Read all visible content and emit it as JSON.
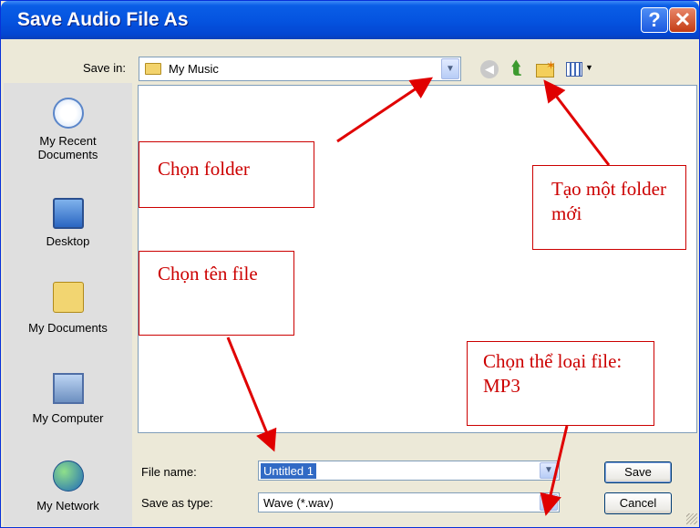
{
  "window": {
    "title": "Save Audio File As",
    "help_glyph": "?",
    "close_glyph": "✕"
  },
  "save_in": {
    "label": "Save in:",
    "value": "My Music"
  },
  "toolbar": {
    "back_glyph": "◀",
    "up_glyph": "⮬"
  },
  "places": [
    {
      "label": "My Recent Documents",
      "icon": "recent-documents-icon"
    },
    {
      "label": "Desktop",
      "icon": "desktop-icon"
    },
    {
      "label": "My Documents",
      "icon": "my-documents-icon"
    },
    {
      "label": "My Computer",
      "icon": "my-computer-icon"
    },
    {
      "label": "My Network",
      "icon": "my-network-icon"
    }
  ],
  "file_name": {
    "label": "File name:",
    "value": "Untitled 1"
  },
  "save_as_type": {
    "label": "Save as type:",
    "value": "Wave (*.wav)"
  },
  "buttons": {
    "save": "Save",
    "cancel": "Cancel"
  },
  "annotations": {
    "choose_folder": "Chọn folder",
    "new_folder": "Tạo một folder mới",
    "choose_name": "Chọn tên file",
    "choose_type": "Chọn thể loại file: MP3"
  },
  "colors": {
    "title_bar": "#0554e0",
    "annotation": "#cc0000",
    "dialog_bg": "#ece9d8"
  }
}
